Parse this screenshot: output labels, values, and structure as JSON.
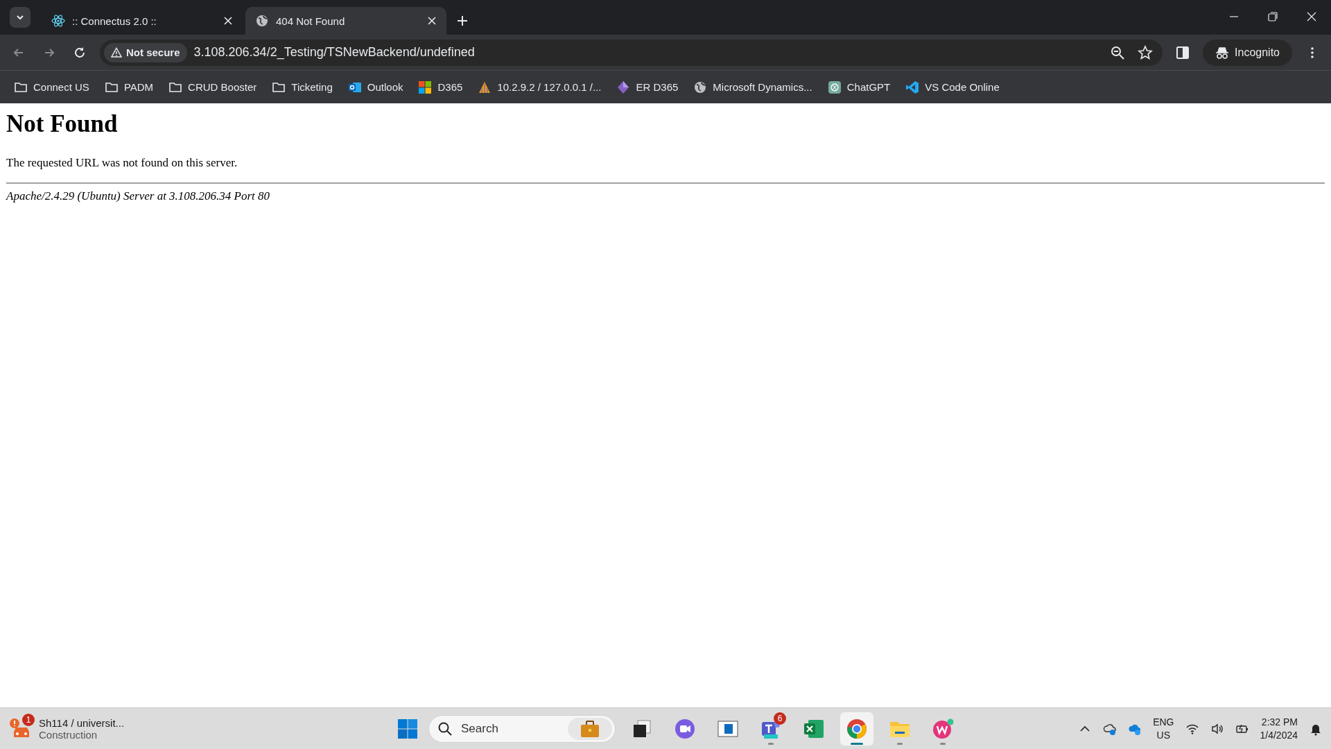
{
  "tabs": [
    {
      "title": ":: Connectus 2.0 ::",
      "kind": "react",
      "selected": false
    },
    {
      "title": "404 Not Found",
      "kind": "globe",
      "selected": true
    }
  ],
  "toolbar": {
    "security": "Not secure",
    "url": "3.108.206.34/2_Testing/TSNewBackend/undefined",
    "profile": "Incognito"
  },
  "bookmarks": [
    {
      "label": "Connect US",
      "kind": "folder"
    },
    {
      "label": "PADM",
      "kind": "folder"
    },
    {
      "label": "CRUD Booster",
      "kind": "folder"
    },
    {
      "label": "Ticketing",
      "kind": "folder"
    },
    {
      "label": "Outlook",
      "kind": "outlook"
    },
    {
      "label": "D365",
      "kind": "windows"
    },
    {
      "label": "10.2.9.2 / 127.0.0.1 /...",
      "kind": "pma"
    },
    {
      "label": "ER D365",
      "kind": "diamond"
    },
    {
      "label": "Microsoft Dynamics...",
      "kind": "globe"
    },
    {
      "label": "ChatGPT",
      "kind": "chatgpt"
    },
    {
      "label": "VS Code Online",
      "kind": "vscode"
    }
  ],
  "page": {
    "heading": "Not Found",
    "message": "The requested URL was not found on this server.",
    "signature": "Apache/2.4.29 (Ubuntu) Server at 3.108.206.34 Port 80"
  },
  "taskbar": {
    "widget": {
      "badge": "1",
      "title": "Sh114 / universit...",
      "subtitle": "Construction"
    },
    "search": {
      "placeholder": "Search"
    },
    "apps": [
      {
        "kind": "taskview",
        "running": false,
        "selected": false
      },
      {
        "kind": "meet",
        "running": false,
        "selected": false
      },
      {
        "kind": "window",
        "running": false,
        "selected": false
      },
      {
        "kind": "teams",
        "badge": "6",
        "running": true,
        "selected": false
      },
      {
        "kind": "excel",
        "running": false,
        "selected": false
      },
      {
        "kind": "chrome",
        "running": true,
        "selected": true
      },
      {
        "kind": "files",
        "running": true,
        "selected": false
      },
      {
        "kind": "wps",
        "running": true,
        "selected": false
      }
    ],
    "tray": {
      "language": "ENG",
      "region": "US",
      "time": "2:32 PM",
      "date": "1/4/2024"
    }
  }
}
